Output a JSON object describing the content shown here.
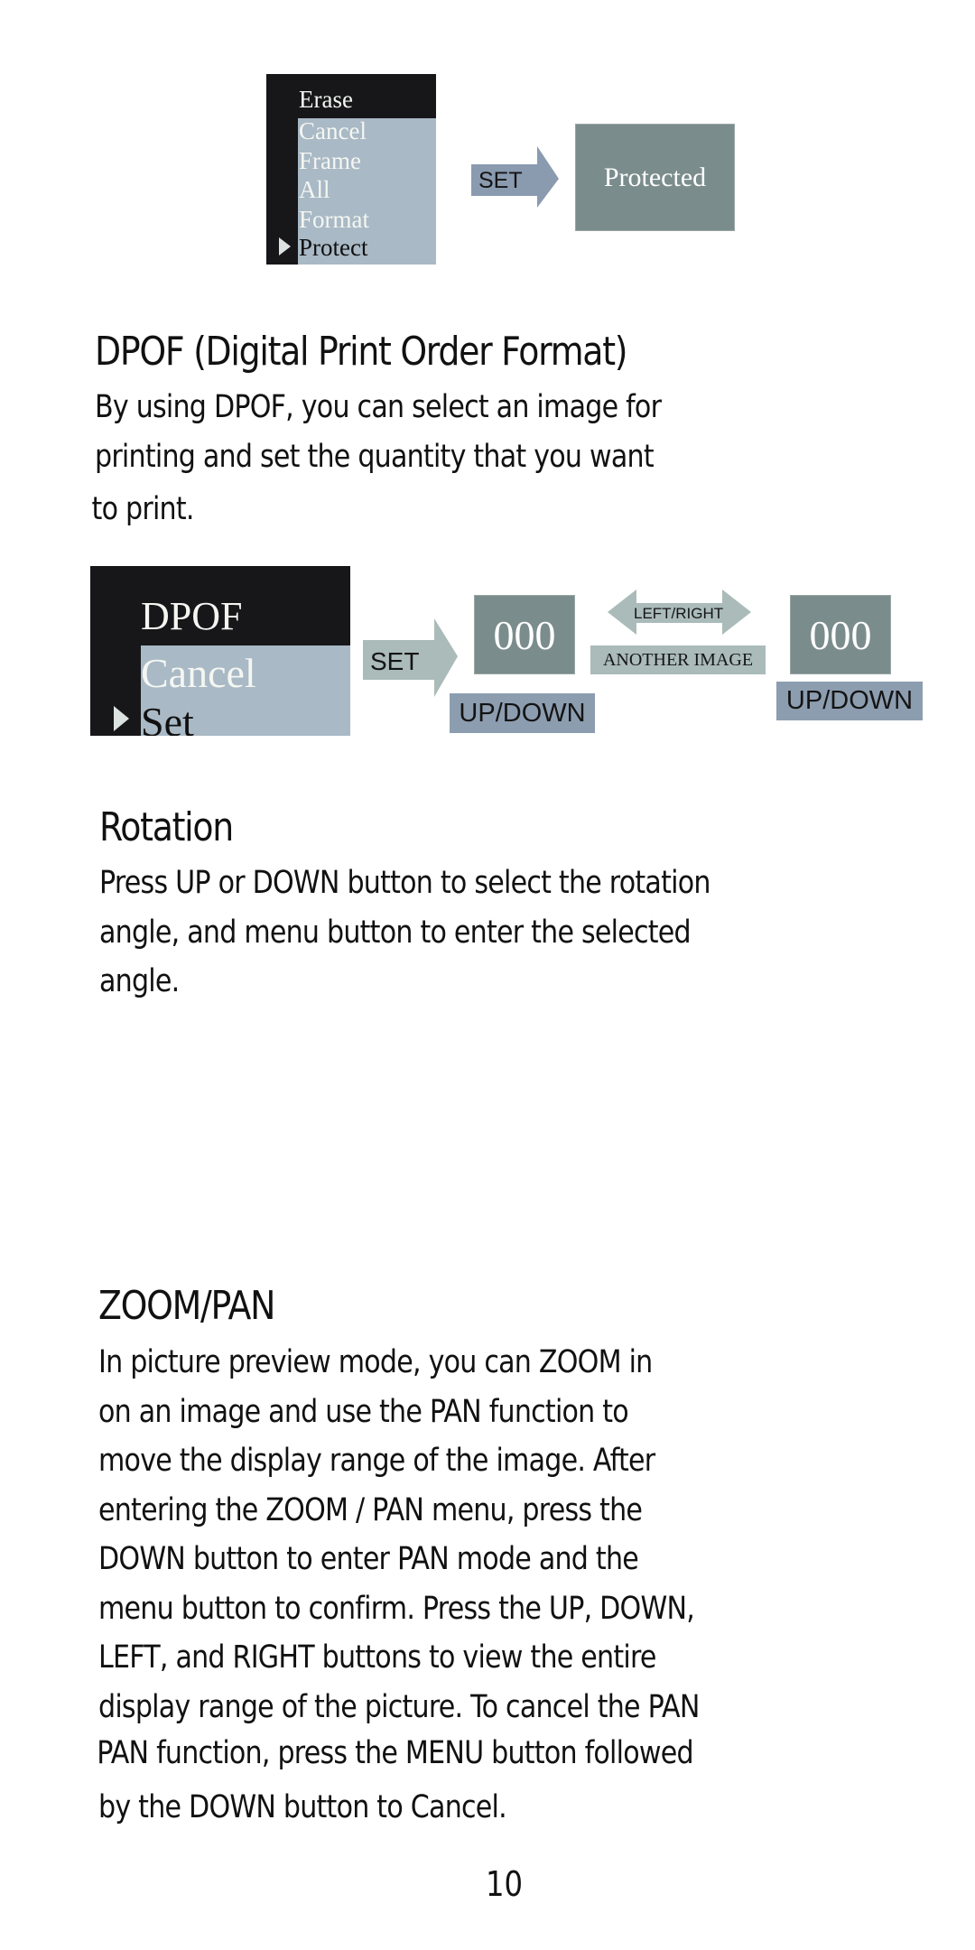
{
  "figures": {
    "protect": {
      "menu": {
        "header": "Erase",
        "items": [
          "Cancel",
          "Frame",
          "All",
          "Format",
          "Protect"
        ],
        "selected_item": "Protect"
      },
      "arrow_label": "SET",
      "result_label": "Protected"
    },
    "dpof": {
      "menu": {
        "header": "DPOF",
        "items": [
          "Cancel",
          "Set"
        ],
        "selected_item": "Set"
      },
      "arrow_label": "SET",
      "quantity_left": "000",
      "updown_left": "UP/DOWN",
      "leftright_label": "LEFT/RIGHT",
      "another_image_label": "ANOTHER IMAGE",
      "quantity_right": "000",
      "updown_right": "UP/DOWN"
    }
  },
  "sections": {
    "dpof": {
      "title": "DPOF (Digital Print Order Format)",
      "lines": [
        "By using DPOF, you can select an image for",
        "printing and set the quantity that you want",
        "to print."
      ]
    },
    "rotation": {
      "title": "Rotation",
      "lines": [
        "Press UP or DOWN button to select the rotation",
        "angle, and menu button to enter the selected",
        "angle."
      ]
    },
    "zoom_pan": {
      "title": "ZOOM/PAN",
      "lines": [
        "In picture preview mode, you can ZOOM in",
        "on an image and use the PAN function to",
        "move the display range of the image.  After",
        "entering the ZOOM / PAN menu, press the",
        "DOWN button to enter PAN mode and the",
        "menu button to confirm.  Press the UP, DOWN,",
        "LEFT, and RIGHT buttons to view the entire",
        "display range of the picture.  To cancel the PAN",
        "PAN function, press the MENU button followed",
        "by the DOWN button to Cancel."
      ]
    }
  },
  "page_number": "10",
  "colors": {
    "menu_dark": "#17171a",
    "menu_panel": "#a9b9c5",
    "screen_box": "#7b8c8c",
    "set_arrow_blue": "#8a9bb0",
    "set_arrow_gray": "#aabbb9",
    "updown_label": "#8d9db0",
    "another_image_label": "#aabbb9"
  }
}
